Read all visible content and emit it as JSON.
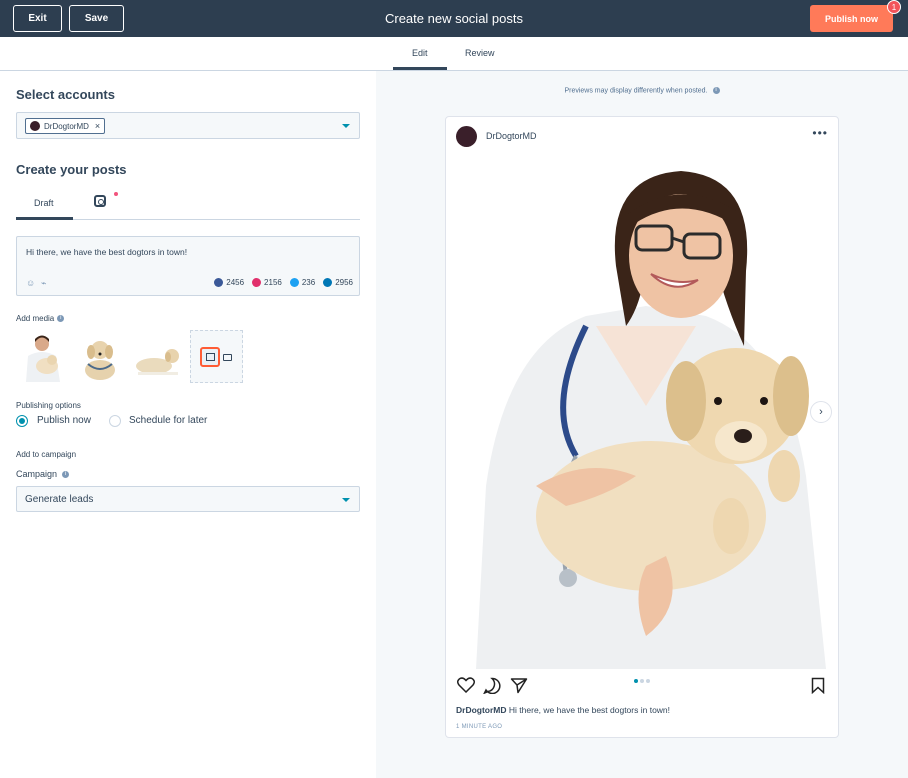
{
  "topbar": {
    "exit_label": "Exit",
    "save_label": "Save",
    "title": "Create new social posts",
    "publish_label": "Publish now",
    "publish_badge": "1"
  },
  "mode_tabs": {
    "edit": "Edit",
    "review": "Review",
    "active": "edit"
  },
  "accounts": {
    "heading": "Select accounts",
    "selected": [
      {
        "name": "DrDogtorMD"
      }
    ]
  },
  "create": {
    "heading": "Create your posts",
    "draft_tab": "Draft",
    "post_text": "Hi there, we have the best dogtors in town!",
    "counts": [
      {
        "network": "facebook",
        "value": "2456",
        "color": "#3b5998"
      },
      {
        "network": "instagram",
        "value": "2156",
        "color": "#e1306c"
      },
      {
        "network": "twitter",
        "value": "236",
        "color": "#1da1f2"
      },
      {
        "network": "linkedin",
        "value": "2956",
        "color": "#0077b5"
      }
    ]
  },
  "media": {
    "label": "Add media"
  },
  "publishing": {
    "label": "Publishing options",
    "options": [
      "Publish now",
      "Schedule for later"
    ],
    "selected": "Publish now"
  },
  "campaign": {
    "section_label": "Add to campaign",
    "field_label": "Campaign",
    "value": "Generate leads"
  },
  "preview": {
    "note": "Previews may display differently when posted.",
    "account_name": "DrDogtorMD",
    "caption_user": "DrDogtorMD",
    "caption_text": "Hi there, we have the best dogtors in town!",
    "time": "1 MINUTE AGO"
  },
  "colors": {
    "topbar": "#2d3e50",
    "accent": "#ff7a59",
    "link": "#0091ae"
  }
}
